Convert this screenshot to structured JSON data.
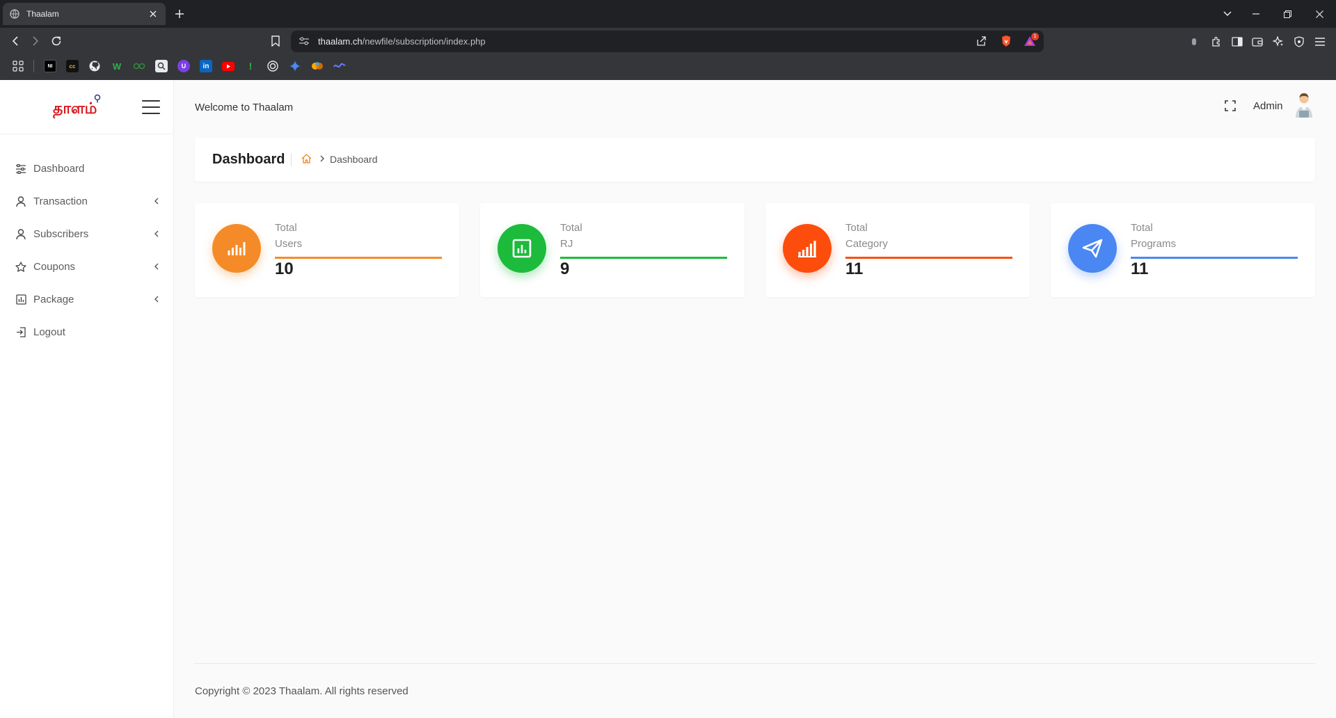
{
  "browser": {
    "tab_title": "Thaalam",
    "url_host": "thaalam.ch",
    "url_path": "/newfile/subscription/index.php",
    "notification_count": "1",
    "bookmarks": [
      "NI",
      "cc",
      "GitHub",
      "W",
      "Coursera",
      "Search",
      "U",
      "in",
      "YouTube",
      "!",
      "Target",
      "Gemini",
      "Colab",
      "Notes"
    ]
  },
  "app": {
    "welcome": "Welcome to Thaalam",
    "user_name": "Admin",
    "logo_text": "தாளம்",
    "menu": [
      {
        "label": "Dashboard",
        "icon": "sliders-icon",
        "has_chevron": false
      },
      {
        "label": "Transaction",
        "icon": "user-icon",
        "has_chevron": true
      },
      {
        "label": "Subscribers",
        "icon": "user-icon",
        "has_chevron": true
      },
      {
        "label": "Coupons",
        "icon": "star-icon",
        "has_chevron": true
      },
      {
        "label": "Package",
        "icon": "chart-box-icon",
        "has_chevron": true
      },
      {
        "label": "Logout",
        "icon": "logout-icon",
        "has_chevron": false
      }
    ],
    "page_title": "Dashboard",
    "breadcrumb_current": "Dashboard",
    "stats": [
      {
        "line1": "Total",
        "line2": "Users",
        "value": "10",
        "color": "#f58b28"
      },
      {
        "line1": "Total",
        "line2": "RJ",
        "value": "9",
        "color": "#1cbb3c"
      },
      {
        "line1": "Total",
        "line2": "Category",
        "value": "11",
        "color": "#fd4d0c"
      },
      {
        "line1": "Total",
        "line2": "Programs",
        "value": "11",
        "color": "#4a87f2"
      }
    ],
    "footer": "Copyright © 2023 Thaalam. All rights reserved"
  }
}
